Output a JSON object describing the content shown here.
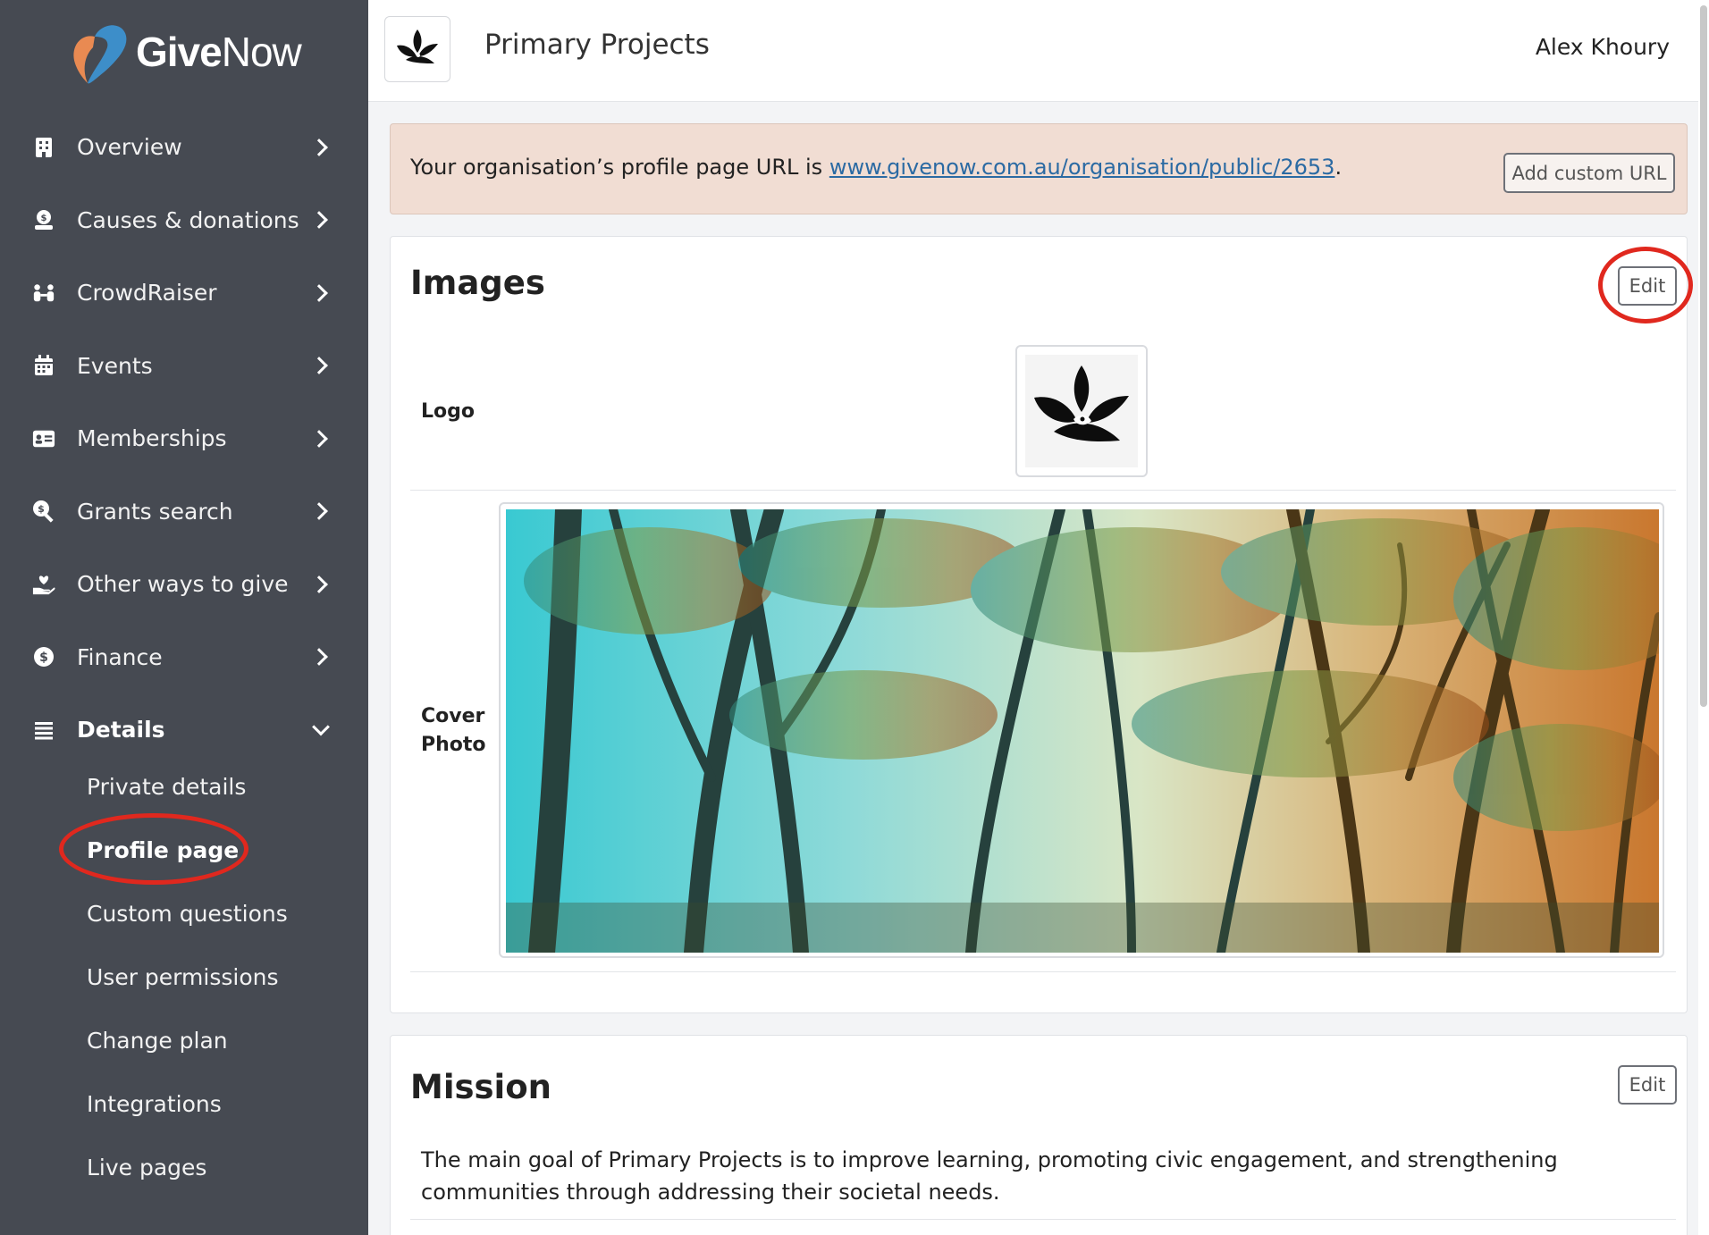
{
  "brand": {
    "give": "Give",
    "now": "Now"
  },
  "sidebar": {
    "items": [
      {
        "label": "Overview",
        "icon": "building-icon"
      },
      {
        "label": "Causes & donations",
        "icon": "donation-icon"
      },
      {
        "label": "CrowdRaiser",
        "icon": "people-icon"
      },
      {
        "label": "Events",
        "icon": "calendar-icon"
      },
      {
        "label": "Memberships",
        "icon": "id-card-icon"
      },
      {
        "label": "Grants search",
        "icon": "search-dollar-icon"
      },
      {
        "label": "Other ways to give",
        "icon": "hand-heart-icon"
      },
      {
        "label": "Finance",
        "icon": "coin-icon"
      },
      {
        "label": "Details",
        "icon": "list-icon"
      }
    ],
    "details_sub": [
      "Private details",
      "Profile page",
      "Custom questions",
      "User permissions",
      "Change plan",
      "Integrations",
      "Live pages"
    ]
  },
  "header": {
    "org_name": "Primary Projects",
    "user_name": "Alex Khoury"
  },
  "banner": {
    "text_before": "Your organisation’s profile page URL is ",
    "url": "www.givenow.com.au/organisation/public/2653",
    "text_after": ".",
    "button": "Add custom URL"
  },
  "images_card": {
    "title": "Images",
    "edit": "Edit",
    "logo_label": "Logo",
    "cover_label_1": "Cover",
    "cover_label_2": "Photo"
  },
  "mission_card": {
    "title": "Mission",
    "edit": "Edit",
    "text": "The main goal of Primary Projects is to improve learning, promoting civic engagement, and strengthening communities through addressing their societal needs."
  },
  "colors": {
    "sidebar_bg": "#464a52",
    "highlight_circle": "#e0281e",
    "banner_bg": "#f1ddd3",
    "link": "#2b6aa3"
  }
}
